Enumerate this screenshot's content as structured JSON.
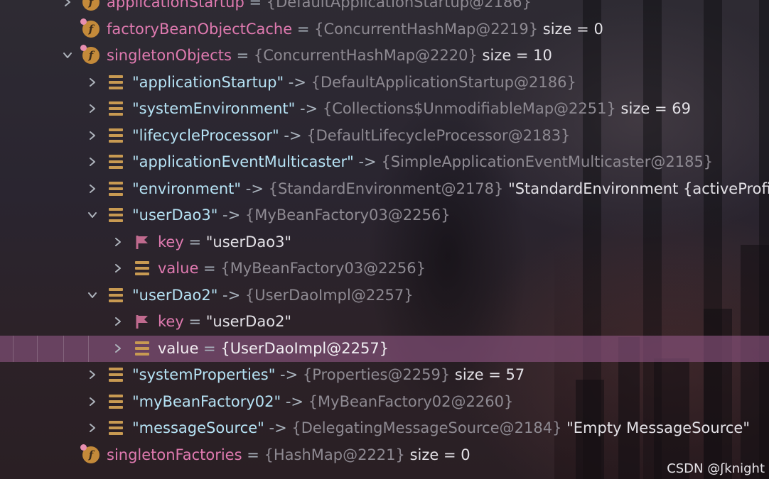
{
  "rows": [
    {
      "chev": "collapsed",
      "icon": "field",
      "lock": false,
      "name": "applicationStartup",
      "name_class": "pink",
      "op": " = ",
      "ref": "{DefaultApplicationStartup@2186}",
      "extra": ""
    },
    {
      "chev": "none",
      "icon": "field",
      "lock": true,
      "name": "factoryBeanObjectCache",
      "name_class": "pink",
      "op": " = ",
      "ref": "{ConcurrentHashMap@2219}",
      "extra": "size = 0"
    },
    {
      "chev": "expanded",
      "icon": "field",
      "lock": true,
      "name": "singletonObjects",
      "name_class": "pink",
      "op": " = ",
      "ref": "{ConcurrentHashMap@2220}",
      "extra": "size = 10"
    },
    {
      "chev": "collapsed",
      "icon": "list",
      "name": "\"applicationStartup\"",
      "name_class": "cyan",
      "op": " -> ",
      "ref": "{DefaultApplicationStartup@2186}",
      "extra": ""
    },
    {
      "chev": "collapsed",
      "icon": "list",
      "name": "\"systemEnvironment\"",
      "name_class": "cyan",
      "op": " -> ",
      "ref": "{Collections$UnmodifiableMap@2251}",
      "extra": "size = 69"
    },
    {
      "chev": "collapsed",
      "icon": "list",
      "name": "\"lifecycleProcessor\"",
      "name_class": "cyan",
      "op": " -> ",
      "ref": "{DefaultLifecycleProcessor@2183}",
      "extra": ""
    },
    {
      "chev": "collapsed",
      "icon": "list",
      "name": "\"applicationEventMulticaster\"",
      "name_class": "cyan",
      "op": " -> ",
      "ref": "{SimpleApplicationEventMulticaster@2185}",
      "extra": ""
    },
    {
      "chev": "collapsed",
      "icon": "list",
      "name": "\"environment\"",
      "name_class": "cyan",
      "op": " -> ",
      "ref": "{StandardEnvironment@2178}",
      "extra": "\"StandardEnvironment {activeProfile"
    },
    {
      "chev": "expanded",
      "icon": "list",
      "name": "\"userDao3\"",
      "name_class": "cyan",
      "op": " -> ",
      "ref": "{MyBeanFactory03@2256}",
      "extra": ""
    },
    {
      "chev": "collapsed",
      "icon": "flag",
      "name": "key",
      "name_class": "pink",
      "op": " = ",
      "ref": "",
      "extra": "\"userDao3\""
    },
    {
      "chev": "collapsed",
      "icon": "list",
      "name": "value",
      "name_class": "pink",
      "op": " = ",
      "ref": "{MyBeanFactory03@2256}",
      "extra": ""
    },
    {
      "chev": "expanded",
      "icon": "list",
      "name": "\"userDao2\"",
      "name_class": "cyan",
      "op": " -> ",
      "ref": "{UserDaoImpl@2257}",
      "extra": ""
    },
    {
      "chev": "collapsed",
      "icon": "flag",
      "name": "key",
      "name_class": "pink",
      "op": " = ",
      "ref": "",
      "extra": "\"userDao2\""
    },
    {
      "chev": "collapsed",
      "icon": "list",
      "name": "value",
      "name_class": "pink",
      "op": " = ",
      "ref": "{UserDaoImpl@2257}",
      "extra": "",
      "selected": true
    },
    {
      "chev": "collapsed",
      "icon": "list",
      "name": "\"systemProperties\"",
      "name_class": "cyan",
      "op": " -> ",
      "ref": "{Properties@2259}",
      "extra": "size = 57"
    },
    {
      "chev": "collapsed",
      "icon": "list",
      "name": "\"myBeanFactory02\"",
      "name_class": "cyan",
      "op": " -> ",
      "ref": "{MyBeanFactory02@2260}",
      "extra": ""
    },
    {
      "chev": "collapsed",
      "icon": "list",
      "name": "\"messageSource\"",
      "name_class": "cyan",
      "op": " -> ",
      "ref": "{DelegatingMessageSource@2184}",
      "extra": "\"Empty MessageSource\""
    },
    {
      "chev": "none",
      "icon": "field",
      "lock": true,
      "name": "singletonFactories",
      "name_class": "pink",
      "op": " = ",
      "ref": "{HashMap@2221}",
      "extra": "size = 0"
    }
  ],
  "watermark": "CSDN @ʃknight",
  "colors": {
    "field_icon": "#c48a3a",
    "list_icon": "#c89a52",
    "flag_icon": "#c06a8e",
    "selection": "#8e5682"
  }
}
